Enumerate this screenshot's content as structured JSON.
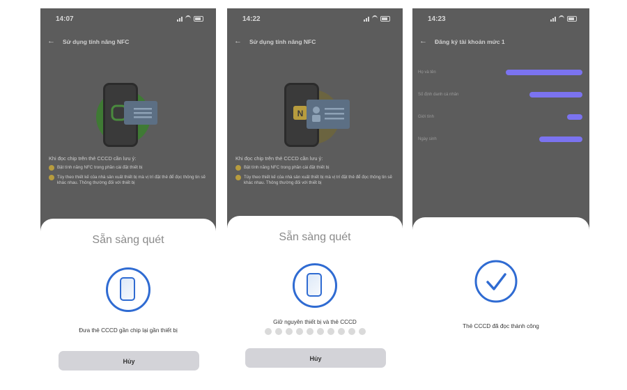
{
  "screens": [
    {
      "time": "14:07",
      "nav_title": "Sử dụng tính năng NFC",
      "notes_heading": "Khi đọc chip trên thẻ CCCD cần lưu ý:",
      "note_1": "Bật tính năng NFC trong phần cài đặt thiết bị",
      "note_2": "Tùy theo thiết kế của nhà sản xuất thiết bị mà vị trí đặt thẻ để đọc thông tin sẽ khác nhau. Thông thường đối với thiết bị",
      "sheet_title": "Sẵn sàng quét",
      "sheet_message": "Đưa thẻ CCCD gần chip lại gần thiết bị",
      "cancel_label": "Hủy",
      "illustration_icon": "nfc-green-icon",
      "accent_color": "#5aa84a"
    },
    {
      "time": "14:22",
      "nav_title": "Sử dụng tính năng NFC",
      "notes_heading": "Khi đọc chip trên thẻ CCCD cần lưu ý:",
      "note_1": "Bật tính năng NFC trong phần cài đặt thiết bị",
      "note_2": "Tùy theo thiết kế của nhà sản xuất thiết bị mà vị trí đặt thẻ để đọc thông tin sẽ khác nhau. Thông thường đối với thiết bị",
      "sheet_title": "Sẵn sàng quét",
      "sheet_message": "Giữ nguyên thiết bị và thẻ CCCD",
      "cancel_label": "Hủy",
      "progress_dots": 10,
      "illustration_icon": "nfc-yellow-icon",
      "accent_color": "#b79c3e"
    },
    {
      "time": "14:23",
      "nav_title": "Đăng ký tài khoản mức 1",
      "fields": [
        {
          "label": "Họ và tên"
        },
        {
          "label": "Số định danh cá nhân"
        },
        {
          "label": "Giới tính"
        },
        {
          "label": "Ngày sinh"
        }
      ],
      "redaction_color": "#7b73f0",
      "success_message": "Thẻ CCCD đã đọc thành công",
      "success_icon": "check-circle-icon"
    }
  ],
  "colors": {
    "primary_blue": "#2f6bd2",
    "dim_overlay": "#5c5c5c",
    "button_gray": "#d3d3d8"
  }
}
